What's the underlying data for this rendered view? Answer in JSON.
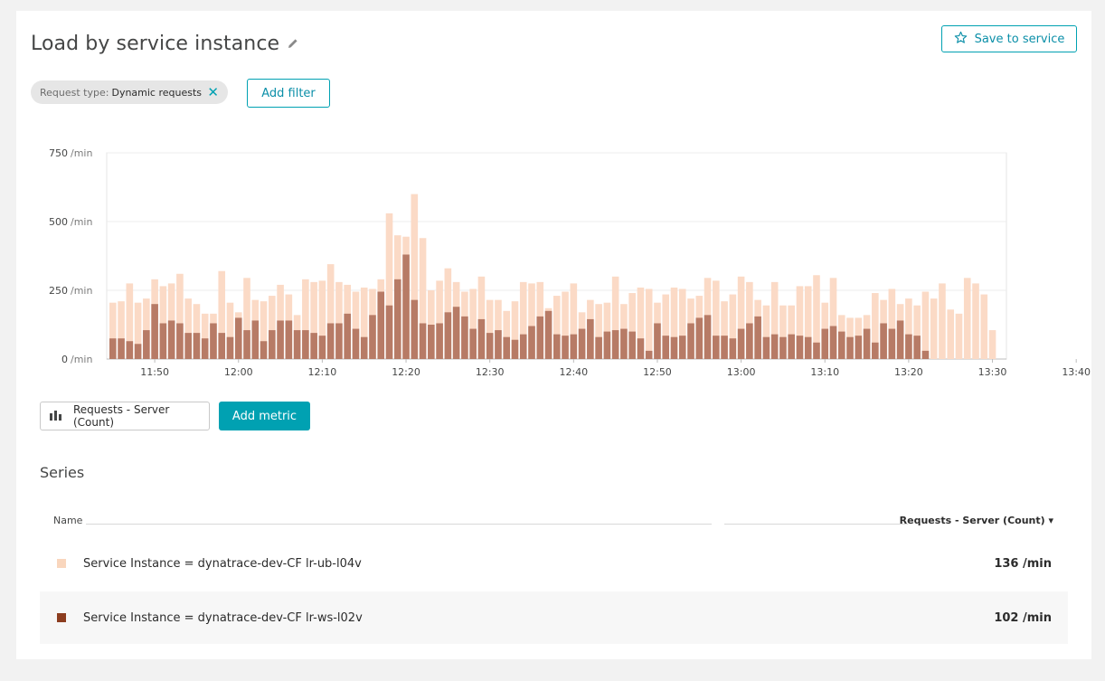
{
  "header": {
    "title": "Load by service instance",
    "save_label": "Save to service"
  },
  "filter": {
    "key": "Request type:",
    "value": "Dynamic requests",
    "add_label": "Add filter"
  },
  "metric": {
    "label": "Requests - Server (Count)",
    "add_label": "Add metric"
  },
  "series_section": {
    "title": "Series",
    "col_name": "Name",
    "col_metric": "Requests - Server (Count) ▾",
    "rows": [
      {
        "name": "Service Instance = dynatrace-dev-CF lr-ub-l04v",
        "value": "136 /min",
        "color": "#f9d6bd"
      },
      {
        "name": "Service Instance = dynatrace-dev-CF lr-ws-l02v",
        "value": "102 /min",
        "color": "#8c3d1f"
      }
    ]
  },
  "colors": {
    "accent": "#00a1b2",
    "series_light": "#fbdac6",
    "series_dark": "#b77b66"
  },
  "chart_data": {
    "type": "bar",
    "stacked": false,
    "yticks": [
      {
        "value": 750,
        "label": "750",
        "unit": "/min"
      },
      {
        "value": 500,
        "label": "500",
        "unit": "/min"
      },
      {
        "value": 250,
        "label": "250",
        "unit": "/min"
      },
      {
        "value": 0,
        "label": "0",
        "unit": "/min"
      }
    ],
    "ylim": [
      0,
      750
    ],
    "xticks": [
      "11:50",
      "12:00",
      "12:10",
      "12:20",
      "12:30",
      "12:40",
      "12:50",
      "13:00",
      "13:10",
      "13:20",
      "13:30",
      "13:40"
    ],
    "x_start": "11:45",
    "grid": true,
    "series": [
      {
        "name": "Service Instance = dynatrace-dev-CF lr-ub-l04v",
        "values": [
          205,
          210,
          275,
          205,
          220,
          290,
          265,
          275,
          310,
          220,
          200,
          165,
          165,
          320,
          205,
          170,
          295,
          215,
          210,
          230,
          270,
          235,
          160,
          290,
          280,
          285,
          345,
          280,
          270,
          245,
          260,
          255,
          290,
          530,
          450,
          445,
          600,
          440,
          250,
          285,
          330,
          280,
          245,
          255,
          300,
          215,
          215,
          175,
          210,
          280,
          275,
          280,
          185,
          230,
          245,
          275,
          170,
          215,
          200,
          205,
          300,
          200,
          240,
          260,
          255,
          205,
          235,
          260,
          255,
          220,
          230,
          295,
          285,
          210,
          235,
          300,
          280,
          215,
          195,
          280,
          195,
          195,
          265,
          265,
          305,
          205,
          295,
          160,
          150,
          150,
          160,
          240,
          215,
          255,
          200,
          220,
          195,
          245,
          220,
          275,
          180,
          165,
          295,
          275,
          235,
          105
        ]
      },
      {
        "name": "Service Instance = dynatrace-dev-CF lr-ws-l02v",
        "values": [
          75,
          75,
          65,
          55,
          105,
          200,
          130,
          140,
          130,
          95,
          95,
          75,
          130,
          95,
          80,
          150,
          105,
          140,
          65,
          105,
          140,
          140,
          105,
          105,
          95,
          85,
          130,
          130,
          165,
          110,
          80,
          160,
          245,
          195,
          290,
          380,
          215,
          130,
          125,
          130,
          170,
          190,
          155,
          110,
          145,
          95,
          105,
          80,
          70,
          90,
          120,
          155,
          175,
          90,
          85,
          90,
          110,
          145,
          80,
          100,
          105,
          110,
          100,
          75,
          30,
          130,
          85,
          80,
          85,
          130,
          150,
          160,
          85,
          85,
          75,
          110,
          130,
          155,
          80,
          90,
          80,
          90,
          85,
          80,
          60,
          110,
          120,
          100,
          80,
          85,
          110,
          60,
          130,
          110,
          140,
          90,
          85,
          30
        ]
      }
    ]
  }
}
